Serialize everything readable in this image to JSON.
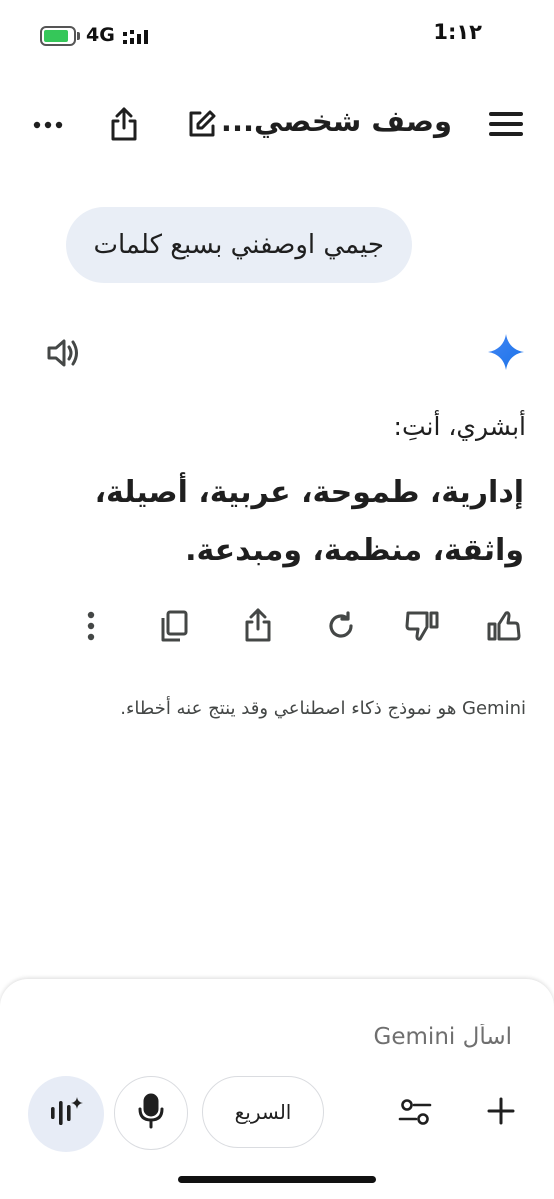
{
  "status_bar": {
    "time": "1:١٢",
    "network": "4G",
    "battery_level": 0.85
  },
  "header": {
    "title": "وصف شخصي..."
  },
  "conversation": {
    "user_message": "جيمي اوصفني بسبع كلمات",
    "response_intro": "أبشري، أنتِ:",
    "response_main": "إدارية، طموحة، عربية، أصيلة، واثقة، منظمة، ومبدعة.",
    "disclaimer": "Gemini هو نموذج ذكاء اصطناعي وقد ينتج عنه أخطاء."
  },
  "composer": {
    "placeholder": "اسأل Gemini",
    "mode_label": "السريع"
  },
  "colors": {
    "bubble_bg": "#e9eef6",
    "gemini_star": "#4285f4",
    "battery_green": "#35c759"
  }
}
